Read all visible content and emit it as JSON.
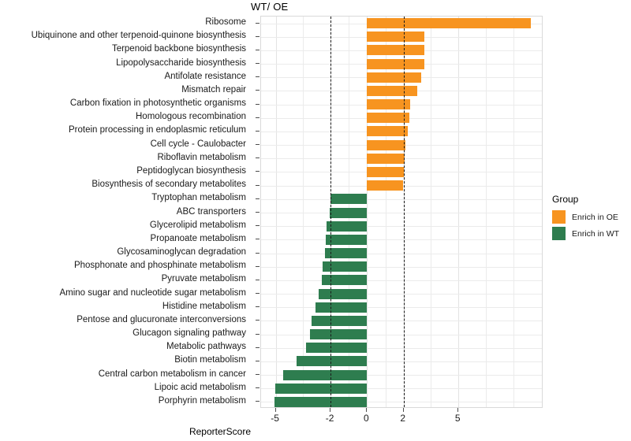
{
  "title": "WT/ OE",
  "axis": {
    "x_label": "ReporterScore",
    "x_ticks": [
      -5,
      -2,
      0,
      2,
      5
    ],
    "x_tick_labels": [
      "-5",
      "-2",
      "0",
      "2",
      "5"
    ],
    "x_min": -5.8,
    "x_max": 9.65
  },
  "legend": {
    "title": "Group",
    "items": [
      {
        "label": "Enrich in OE",
        "color": "#F79420"
      },
      {
        "label": "Enrich in WT",
        "color": "#2E7D4F"
      }
    ]
  },
  "reference_lines": [
    -2,
    2
  ],
  "colors": {
    "enrich_oe": "#F79420",
    "enrich_wt": "#2E7D4F",
    "panel_border": "#d9d9d9",
    "grid": "#ebebeb",
    "dashed_line": "#1a1a1a"
  },
  "chart_data": {
    "type": "bar",
    "orientation": "horizontal",
    "title": "WT/ OE",
    "xlabel": "ReporterScore",
    "ylabel": "",
    "xlim": [
      -5.8,
      9.65
    ],
    "grid": true,
    "legend_position": "right",
    "categories": [
      "Ribosome",
      "Ubiquinone and other terpenoid-quinone biosynthesis",
      "Terpenoid backbone biosynthesis",
      "Lipopolysaccharide biosynthesis",
      "Antifolate resistance",
      "Mismatch repair",
      "Carbon fixation in photosynthetic organisms",
      "Homologous recombination",
      "Protein processing in endoplasmic reticulum",
      "Cell cycle - Caulobacter",
      "Riboflavin metabolism",
      "Peptidoglycan biosynthesis",
      "Biosynthesis of secondary metabolites",
      "Tryptophan metabolism",
      "ABC transporters",
      "Glycerolipid metabolism",
      "Propanoate metabolism",
      "Glycosaminoglycan degradation",
      "Phosphonate and phosphinate metabolism",
      "Pyruvate metabolism",
      "Amino sugar and nucleotide sugar metabolism",
      "Histidine metabolism",
      "Pentose and glucuronate interconversions",
      "Glucagon signaling pathway",
      "Metabolic pathways",
      "Biotin metabolism",
      "Central carbon metabolism in cancer",
      "Lipoic acid metabolism",
      "Porphyrin metabolism"
    ],
    "values": [
      8.96,
      3.15,
      3.13,
      3.13,
      2.96,
      2.75,
      2.35,
      2.3,
      2.23,
      2.1,
      2.05,
      2.02,
      1.98,
      -2.02,
      -2.05,
      -2.22,
      -2.25,
      -2.32,
      -2.45,
      -2.48,
      -2.65,
      -2.82,
      -3.02,
      -3.12,
      -3.35,
      -3.85,
      -4.6,
      -5.02,
      -5.05
    ],
    "groups": [
      "Enrich in OE",
      "Enrich in OE",
      "Enrich in OE",
      "Enrich in OE",
      "Enrich in OE",
      "Enrich in OE",
      "Enrich in OE",
      "Enrich in OE",
      "Enrich in OE",
      "Enrich in OE",
      "Enrich in OE",
      "Enrich in OE",
      "Enrich in OE",
      "Enrich in WT",
      "Enrich in WT",
      "Enrich in WT",
      "Enrich in WT",
      "Enrich in WT",
      "Enrich in WT",
      "Enrich in WT",
      "Enrich in WT",
      "Enrich in WT",
      "Enrich in WT",
      "Enrich in WT",
      "Enrich in WT",
      "Enrich in WT",
      "Enrich in WT",
      "Enrich in WT",
      "Enrich in WT"
    ]
  }
}
